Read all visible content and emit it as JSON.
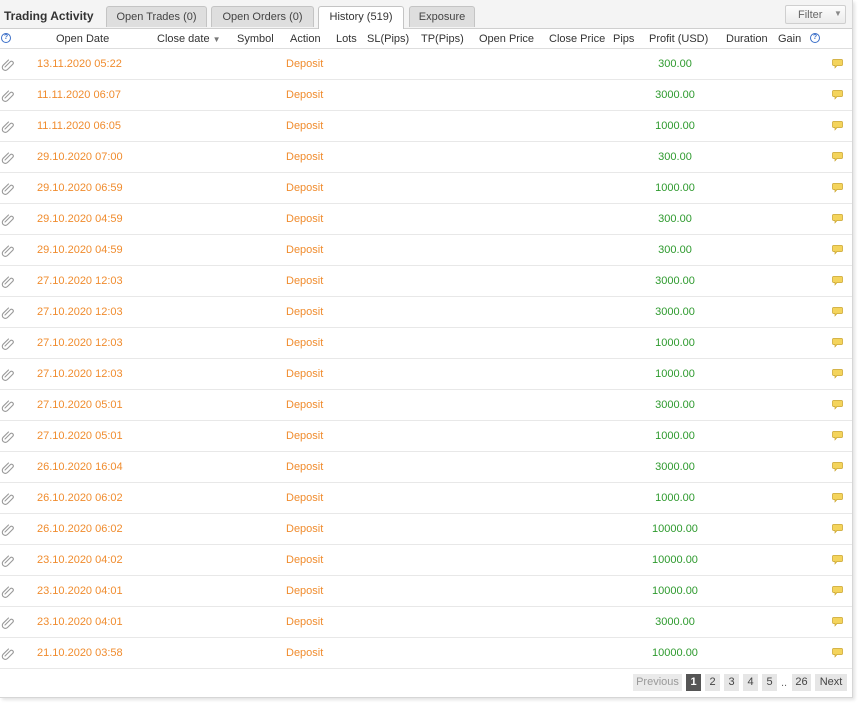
{
  "title": "Trading Activity",
  "tabs": [
    {
      "label": "Open Trades (0)"
    },
    {
      "label": "Open Orders (0)"
    },
    {
      "label": "History (519)"
    },
    {
      "label": "Exposure"
    }
  ],
  "filter_label": "Filter",
  "columns": {
    "open_date": "Open Date",
    "close_date": "Close date",
    "symbol": "Symbol",
    "action": "Action",
    "lots": "Lots",
    "sl": "SL(Pips)",
    "tp": "TP(Pips)",
    "open_price": "Open Price",
    "close_price": "Close Price",
    "pips": "Pips",
    "profit": "Profit (USD)",
    "duration": "Duration",
    "gain": "Gain"
  },
  "icons": {
    "row_icon": "paperclip-icon",
    "comment_icon": "comment-icon",
    "help_icon": "help-icon",
    "sort_icon": "sort-down-icon"
  },
  "colors": {
    "date": "#f08c2e",
    "action": "#f08c2e",
    "profit": "#2e9a2e",
    "accent": "#3b6fc8"
  },
  "rows": [
    {
      "open_date": "13.11.2020 05:22",
      "action": "Deposit",
      "profit": "300.00"
    },
    {
      "open_date": "11.11.2020 06:07",
      "action": "Deposit",
      "profit": "3000.00"
    },
    {
      "open_date": "11.11.2020 06:05",
      "action": "Deposit",
      "profit": "1000.00"
    },
    {
      "open_date": "29.10.2020 07:00",
      "action": "Deposit",
      "profit": "300.00"
    },
    {
      "open_date": "29.10.2020 06:59",
      "action": "Deposit",
      "profit": "1000.00"
    },
    {
      "open_date": "29.10.2020 04:59",
      "action": "Deposit",
      "profit": "300.00"
    },
    {
      "open_date": "29.10.2020 04:59",
      "action": "Deposit",
      "profit": "300.00"
    },
    {
      "open_date": "27.10.2020 12:03",
      "action": "Deposit",
      "profit": "3000.00"
    },
    {
      "open_date": "27.10.2020 12:03",
      "action": "Deposit",
      "profit": "3000.00"
    },
    {
      "open_date": "27.10.2020 12:03",
      "action": "Deposit",
      "profit": "1000.00"
    },
    {
      "open_date": "27.10.2020 12:03",
      "action": "Deposit",
      "profit": "1000.00"
    },
    {
      "open_date": "27.10.2020 05:01",
      "action": "Deposit",
      "profit": "3000.00"
    },
    {
      "open_date": "27.10.2020 05:01",
      "action": "Deposit",
      "profit": "1000.00"
    },
    {
      "open_date": "26.10.2020 16:04",
      "action": "Deposit",
      "profit": "3000.00"
    },
    {
      "open_date": "26.10.2020 06:02",
      "action": "Deposit",
      "profit": "1000.00"
    },
    {
      "open_date": "26.10.2020 06:02",
      "action": "Deposit",
      "profit": "10000.00"
    },
    {
      "open_date": "23.10.2020 04:02",
      "action": "Deposit",
      "profit": "10000.00"
    },
    {
      "open_date": "23.10.2020 04:01",
      "action": "Deposit",
      "profit": "10000.00"
    },
    {
      "open_date": "23.10.2020 04:01",
      "action": "Deposit",
      "profit": "3000.00"
    },
    {
      "open_date": "21.10.2020 03:58",
      "action": "Deposit",
      "profit": "10000.00"
    }
  ],
  "pagination": {
    "previous": "Previous",
    "pages": [
      "1",
      "2",
      "3",
      "4",
      "5"
    ],
    "ellipsis": "..",
    "last": "26",
    "next": "Next",
    "current": "1"
  }
}
